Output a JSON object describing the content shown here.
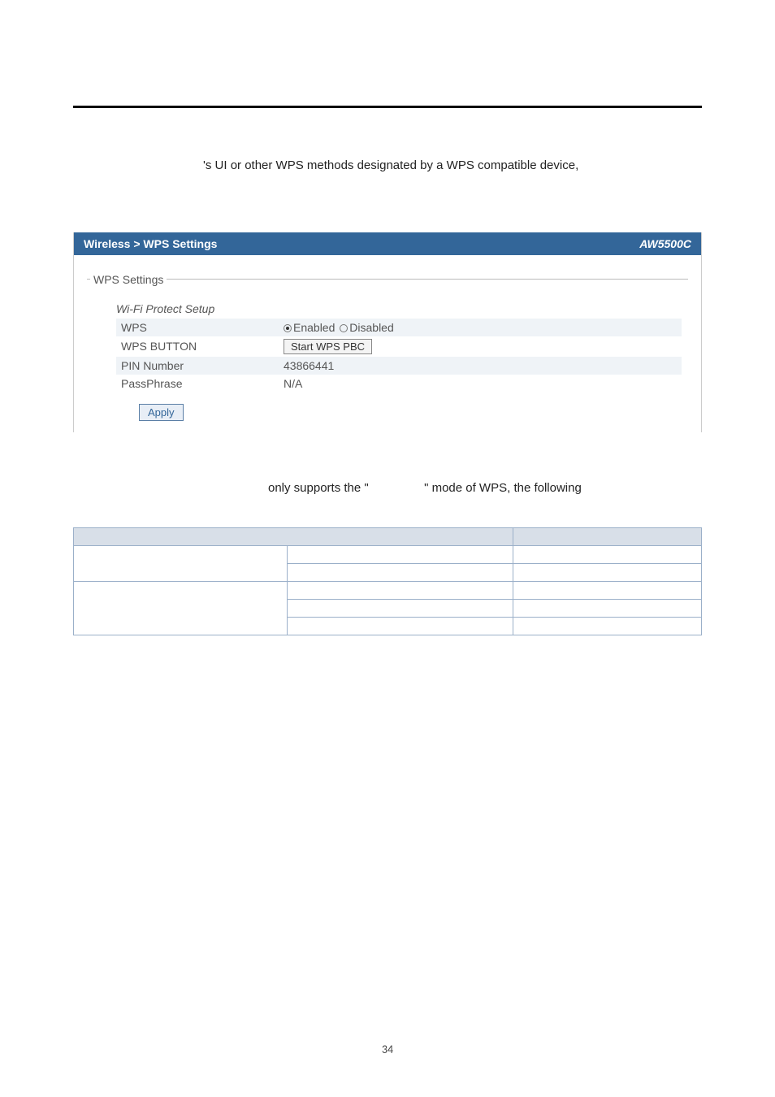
{
  "page": {
    "body_line1": "'s UI or other WPS methods designated by a WPS compatible device,",
    "page_number": "34"
  },
  "panel": {
    "breadcrumb": "Wireless > WPS Settings",
    "model": "AW5500C",
    "fieldset_title": "WPS Settings",
    "wifi_title": "Wi-Fi Protect Setup",
    "rows": {
      "wps_label": "WPS",
      "wps_enabled": "Enabled",
      "wps_disabled": "Disabled",
      "wps_button_label": "WPS BUTTON",
      "start_btn": "Start WPS PBC",
      "pin_label": "PIN Number",
      "pin_value": "43866441",
      "pass_label": "PassPhrase",
      "pass_value": "N/A"
    },
    "apply_label": "Apply"
  },
  "note": {
    "l1_a": "only  supports  the  \"",
    "l1_b": "\"  mode  of  WPS,  the  following"
  },
  "features": {
    "head1": " ",
    "head2": " ",
    "r1c1": " ",
    "r1c2": " ",
    "r1c3": " ",
    "r2c2": " ",
    "r2c3": " ",
    "r3c1": " ",
    "r3c2": " ",
    "r3c3": " ",
    "r4c2": " ",
    "r4c3": " ",
    "r5c2": " ",
    "r5c3": " "
  }
}
